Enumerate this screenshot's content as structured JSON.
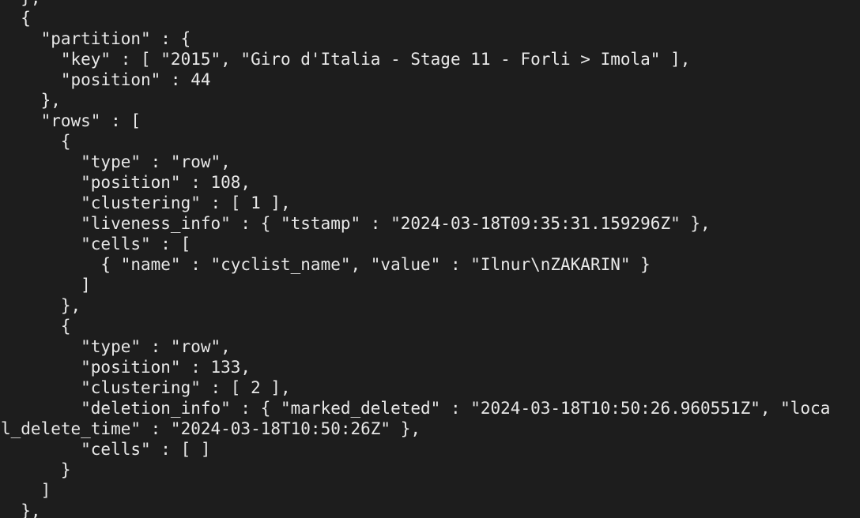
{
  "terminal": {
    "background_color": "#1d1d1d",
    "text_color": "#e8e8e8",
    "lines": [
      "  },",
      "  {",
      "    \"partition\" : {",
      "      \"key\" : [ \"2015\", \"Giro d'Italia - Stage 11 - Forli > Imola\" ],",
      "      \"position\" : 44",
      "    },",
      "    \"rows\" : [",
      "      {",
      "        \"type\" : \"row\",",
      "        \"position\" : 108,",
      "        \"clustering\" : [ 1 ],",
      "        \"liveness_info\" : { \"tstamp\" : \"2024-03-18T09:35:31.159296Z\" },",
      "        \"cells\" : [",
      "          { \"name\" : \"cyclist_name\", \"value\" : \"Ilnur\\nZAKARIN\" }",
      "        ]",
      "      },",
      "      {",
      "        \"type\" : \"row\",",
      "        \"position\" : 133,",
      "        \"clustering\" : [ 2 ],",
      "        \"deletion_info\" : { \"marked_deleted\" : \"2024-03-18T10:50:26.960551Z\", \"loca",
      "l_delete_time\" : \"2024-03-18T10:50:26Z\" },",
      "        \"cells\" : [ ]",
      "      }",
      "    ]",
      "  },"
    ]
  }
}
